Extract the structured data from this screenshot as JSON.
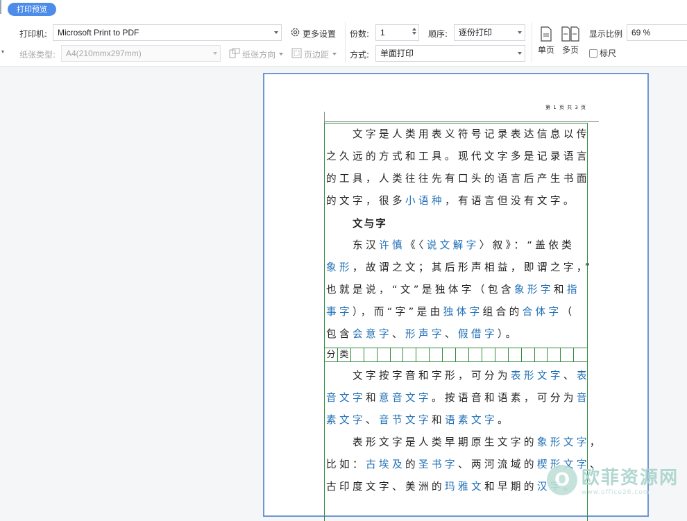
{
  "app": {
    "tab_label": "打印预览"
  },
  "printer": {
    "label": "打印机:",
    "value": "Microsoft Print to PDF",
    "more_settings": "更多设置"
  },
  "paper": {
    "type_label": "纸张类型:",
    "type_value": "A4(210mmx297mm)",
    "orientation": "纸张方向",
    "margins": "页边距"
  },
  "copies": {
    "label": "份数:",
    "value": "1"
  },
  "order": {
    "label": "顺序:",
    "value": "逐份打印"
  },
  "mode": {
    "label": "方式:",
    "value": "单面打印"
  },
  "view": {
    "single": "单页",
    "multi": "多页",
    "zoom_label": "显示比例",
    "zoom_value": "69 %",
    "ruler": "标尺"
  },
  "page": {
    "header": "第 1 页 共 3 页",
    "heading": "文与字",
    "grid_cells": [
      "分",
      "类",
      "",
      "",
      "",
      "",
      "",
      "",
      "",
      "",
      "",
      "",
      "",
      "",
      "",
      "",
      "",
      "",
      "",
      ""
    ],
    "p1": [
      [
        {
          "t": "　　文字是人类用表义符号记录表达信息以传"
        }
      ],
      [
        {
          "t": "之久远的方式和工具。现代文字多是记录语言"
        }
      ],
      [
        {
          "t": "的工具，人类往往先有口头的语言后产生书面"
        }
      ],
      [
        {
          "t": "的文字，很多"
        },
        {
          "t": "小语种",
          "link": true
        },
        {
          "t": "，有语言但没有文字。"
        }
      ]
    ],
    "p2": [
      [
        {
          "t": "　　东汉"
        },
        {
          "t": "许慎",
          "link": true
        },
        {
          "t": "《〈"
        },
        {
          "t": "说文解字",
          "link": true
        },
        {
          "t": "〉叙》：“盖依类"
        }
      ],
      [
        {
          "t": "象形",
          "link": true
        },
        {
          "t": "，故谓之文；其后形声相益，即谓之字，”"
        }
      ],
      [
        {
          "t": "也就是说，“文”是独体字（包含"
        },
        {
          "t": "象形字",
          "link": true
        },
        {
          "t": "和"
        },
        {
          "t": "指",
          "link": true
        }
      ],
      [
        {
          "t": "事字",
          "link": true
        },
        {
          "t": "），而“字”是由"
        },
        {
          "t": "独体字",
          "link": true
        },
        {
          "t": "组合的"
        },
        {
          "t": "合体字",
          "link": true
        },
        {
          "t": "（"
        }
      ],
      [
        {
          "t": "包含"
        },
        {
          "t": "会意字",
          "link": true
        },
        {
          "t": "、"
        },
        {
          "t": "形声字",
          "link": true
        },
        {
          "t": "、"
        },
        {
          "t": "假借字",
          "link": true
        },
        {
          "t": "）。"
        }
      ]
    ],
    "p3": [
      [
        {
          "t": "　　文字按字音和字形，可分为"
        },
        {
          "t": "表形文字",
          "link": true
        },
        {
          "t": "、"
        },
        {
          "t": "表",
          "link": true
        }
      ],
      [
        {
          "t": "音文字",
          "link": true
        },
        {
          "t": "和"
        },
        {
          "t": "意音文字",
          "link": true
        },
        {
          "t": "。按语音和语素，可分为"
        },
        {
          "t": "音",
          "link": true
        }
      ],
      [
        {
          "t": "素文字",
          "link": true
        },
        {
          "t": "、"
        },
        {
          "t": "音节文字",
          "link": true
        },
        {
          "t": "和"
        },
        {
          "t": "语素文字",
          "link": true
        },
        {
          "t": "。"
        }
      ]
    ],
    "p4": [
      [
        {
          "t": "　　表形文字是人类早期原生文字的"
        },
        {
          "t": "象形文字",
          "link": true
        },
        {
          "t": "，"
        }
      ],
      [
        {
          "t": "比如："
        },
        {
          "t": "古埃及",
          "link": true
        },
        {
          "t": "的"
        },
        {
          "t": "圣书字",
          "link": true
        },
        {
          "t": "、两河流域的"
        },
        {
          "t": "楔形文字",
          "link": true
        },
        {
          "t": "、"
        }
      ],
      [
        {
          "t": "古印度文字、美洲的"
        },
        {
          "t": "玛雅文",
          "link": true
        },
        {
          "t": "和早期的"
        },
        {
          "t": "汉字",
          "link": true
        },
        {
          "t": "。"
        }
      ]
    ]
  },
  "watermark": {
    "logo": "O",
    "name": "欧菲资源网",
    "url": "www.office26.com"
  }
}
